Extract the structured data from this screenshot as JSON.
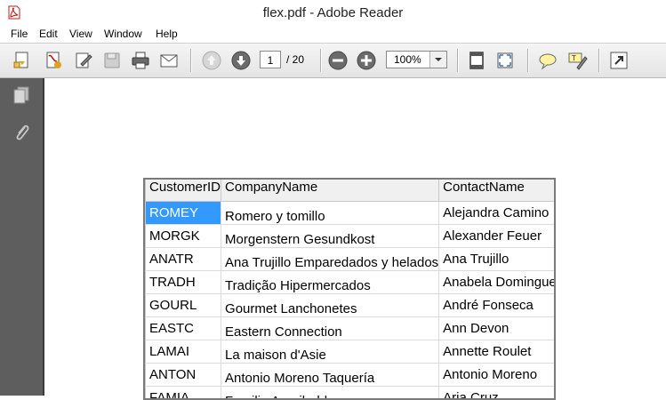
{
  "window": {
    "title": "flex.pdf - Adobe Reader"
  },
  "menu": [
    "File",
    "Edit",
    "View",
    "Window",
    "Help"
  ],
  "toolbar": {
    "page_current": "1",
    "page_total": "/ 20",
    "zoom": "100%"
  },
  "grid": {
    "columns": [
      "CustomerID",
      "CompanyName",
      "ContactName"
    ],
    "rows": [
      [
        "ROMEY",
        "Romero y tomillo",
        "Alejandra Camino"
      ],
      [
        "MORGK",
        "Morgenstern Gesundkost",
        "Alexander Feuer"
      ],
      [
        "ANATR",
        "Ana Trujillo Emparedados y helados",
        "Ana Trujillo"
      ],
      [
        "TRADH",
        "Tradição Hipermercados",
        "Anabela Domingues"
      ],
      [
        "GOURL",
        "Gourmet Lanchonetes",
        "André Fonseca"
      ],
      [
        "EASTC",
        "Eastern Connection",
        "Ann Devon"
      ],
      [
        "LAMAI",
        "La maison d'Asie",
        "Annette Roulet"
      ],
      [
        "ANTON",
        "Antonio Moreno Taquería",
        "Antonio Moreno"
      ],
      [
        "FAMIA",
        "Familia Arquibaldo",
        "Aria Cruz"
      ]
    ]
  },
  "colors": {
    "selection": "#3399ff",
    "nav_bg": "#5e5e5e"
  }
}
